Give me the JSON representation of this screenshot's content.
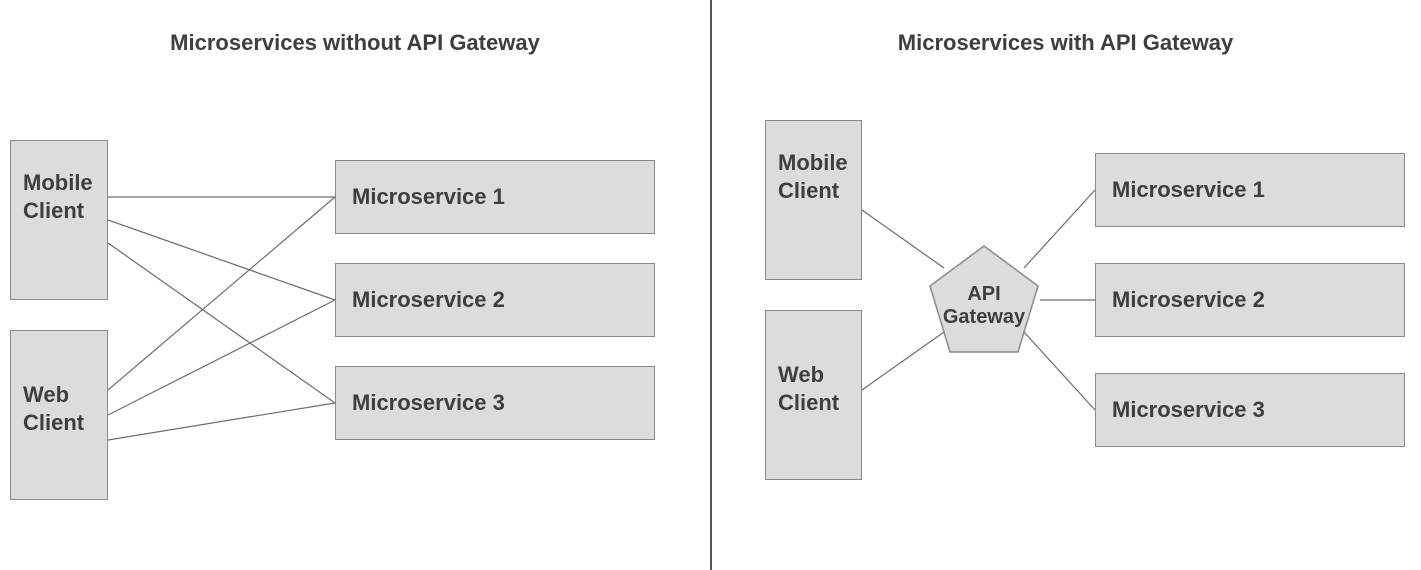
{
  "left": {
    "title": "Microservices without API Gateway",
    "clients": [
      "Mobile Client",
      "Web Client"
    ],
    "services": [
      "Microservice 1",
      "Microservice 2",
      "Microservice 3"
    ]
  },
  "right": {
    "title": "Microservices with API Gateway",
    "clients": [
      "Mobile Client",
      "Web Client"
    ],
    "gateway": "API Gateway",
    "services": [
      "Microservice 1",
      "Microservice 2",
      "Microservice 3"
    ]
  },
  "colors": {
    "box_fill": "#dcdcdc",
    "box_stroke": "#8a8a8a",
    "text": "#3e3e3e",
    "line": "#6d6d6d"
  }
}
